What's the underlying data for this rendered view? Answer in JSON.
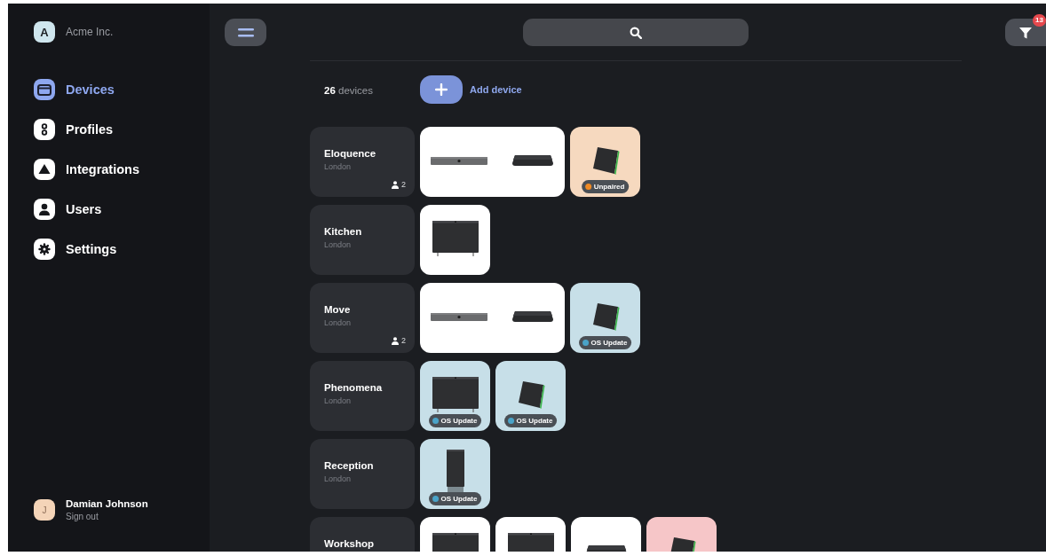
{
  "sidebar": {
    "org": {
      "initial": "A",
      "name": "Acme Inc."
    },
    "items": [
      {
        "label": "Devices",
        "selected": true
      },
      {
        "label": "Profiles",
        "selected": false
      },
      {
        "label": "Integrations",
        "selected": false
      },
      {
        "label": "Users",
        "selected": false
      },
      {
        "label": "Settings",
        "selected": false
      }
    ],
    "user": {
      "initial": "J",
      "name": "Damian Johnson",
      "action": "Sign out"
    }
  },
  "topbar": {
    "filter_count": "13"
  },
  "toolbar": {
    "count": "26",
    "count_label": "devices",
    "add_label": "Add device"
  },
  "rooms": [
    {
      "name": "Eloquence",
      "location": "London",
      "people": "2",
      "tiles": [
        {
          "color": "#ffffff",
          "devices": [
            {
              "kind": "bar"
            },
            {
              "kind": "touch"
            }
          ]
        },
        {
          "color": "#f6d9bf",
          "devices": [
            {
              "kind": "panel"
            }
          ],
          "status": {
            "label": "Unpaired",
            "color": "#f08a24"
          }
        }
      ]
    },
    {
      "name": "Kitchen",
      "location": "London",
      "tiles": [
        {
          "color": "#ffffff",
          "devices": [
            {
              "kind": "display"
            }
          ]
        }
      ]
    },
    {
      "name": "Move",
      "location": "London",
      "people": "2",
      "tiles": [
        {
          "color": "#ffffff",
          "devices": [
            {
              "kind": "bar"
            },
            {
              "kind": "touch"
            }
          ]
        },
        {
          "color": "#c7dfe8",
          "devices": [
            {
              "kind": "panel"
            }
          ],
          "status": {
            "label": "OS Update",
            "color": "#4aa3c8"
          }
        }
      ]
    },
    {
      "name": "Phenomena",
      "location": "London",
      "tiles": [
        {
          "color": "#c7dfe8",
          "devices": [
            {
              "kind": "display"
            }
          ],
          "status": {
            "label": "OS Update",
            "color": "#4aa3c8"
          }
        },
        {
          "color": "#c7dfe8",
          "devices": [
            {
              "kind": "panel"
            }
          ],
          "status": {
            "label": "OS Update",
            "color": "#4aa3c8"
          }
        }
      ]
    },
    {
      "name": "Reception",
      "location": "London",
      "tiles": [
        {
          "color": "#c7dfe8",
          "devices": [
            {
              "kind": "tower"
            }
          ],
          "status": {
            "label": "OS Update",
            "color": "#4aa3c8"
          }
        }
      ]
    },
    {
      "name": "Workshop",
      "tiles": [
        {
          "color": "#ffffff",
          "devices": [
            {
              "kind": "display"
            }
          ]
        },
        {
          "color": "#ffffff",
          "devices": [
            {
              "kind": "display"
            }
          ]
        },
        {
          "color": "#ffffff",
          "devices": [
            {
              "kind": "touch"
            }
          ]
        },
        {
          "color": "#f6c6c8",
          "devices": [
            {
              "kind": "panel"
            }
          ]
        }
      ]
    }
  ]
}
